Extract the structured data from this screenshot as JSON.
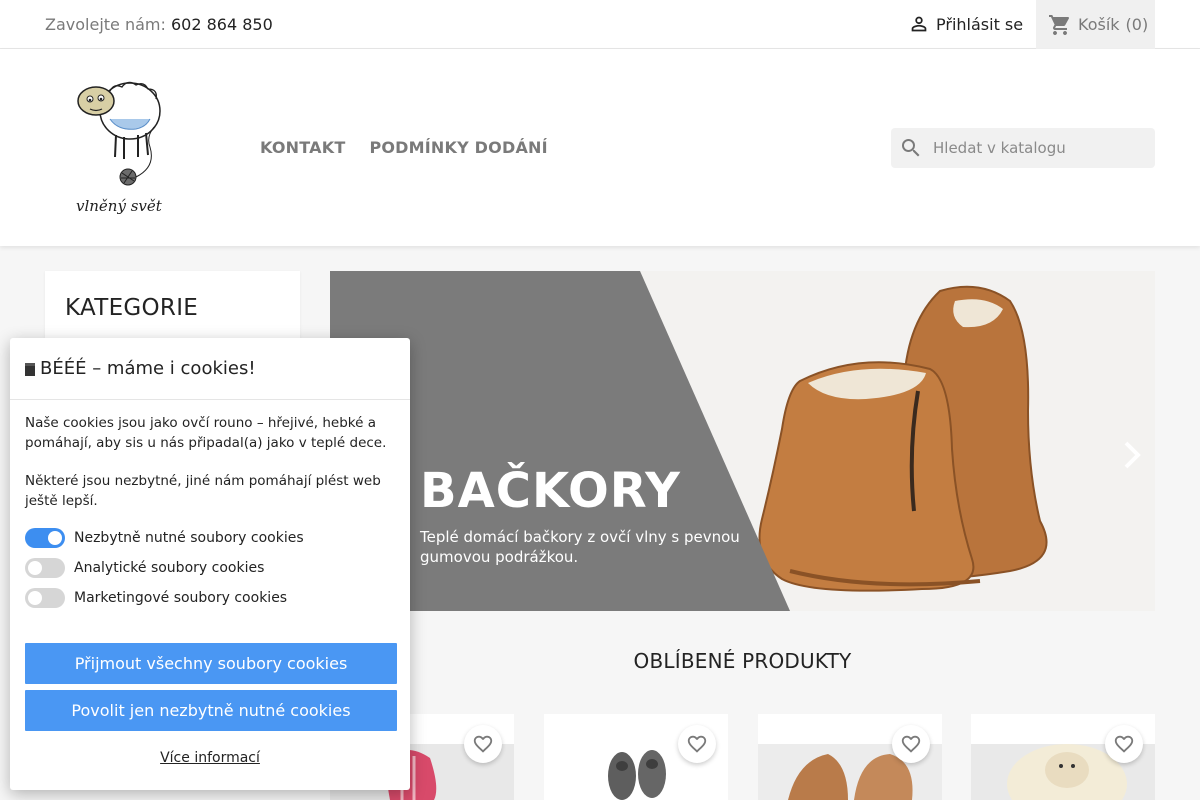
{
  "topbar": {
    "call_label": "Zavolejte nám:",
    "phone": "602 864 850",
    "signin_label": "Přihlásit se",
    "cart_label": "Košík",
    "cart_count": "(0)"
  },
  "header": {
    "logo_text": "vlněný svět",
    "menu": [
      "KONTAKT",
      "PODMÍNKY DODÁNÍ"
    ],
    "search_placeholder": "Hledat v katalogu"
  },
  "sidebar": {
    "title": "KATEGORIE"
  },
  "slider": {
    "title": "BAČKORY",
    "text": "Teplé domácí bačkory z ovčí vlny s pevnou gumovou podrážkou."
  },
  "featured": {
    "title": "OBLÍBENÉ PRODUKTY"
  },
  "cookie": {
    "title": "BÉÉÉ – máme i cookies!",
    "para1": "Naše cookies jsou jako ovčí rouno – hřejivé, hebké a pomáhají, aby sis u nás připadal(a) jako v teplé dece.",
    "para2": "Některé jsou nezbytné, jiné nám pomáhají plést web ještě lepší.",
    "toggles": [
      {
        "label": "Nezbytně nutné soubory cookies",
        "on": true
      },
      {
        "label": "Analytické soubory cookies",
        "on": false
      },
      {
        "label": "Marketingové soubory cookies",
        "on": false
      }
    ],
    "accept_all": "Přijmout všechny soubory cookies",
    "accept_necessary": "Povolit jen nezbytně nutné cookies",
    "more_info": "Více informací"
  },
  "colors": {
    "accent_button": "#4a97f3",
    "toggle_on": "#3d8ef0",
    "slider_panel": "#7b7b7b"
  }
}
